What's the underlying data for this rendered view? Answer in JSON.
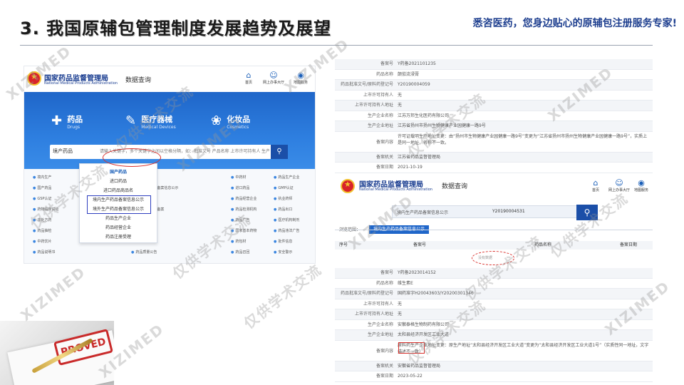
{
  "slide": {
    "title": "3. 我国原辅包管理制度发展趋势及展望",
    "slogan": "悉咨医药，您身边贴心的原辅包注册服务专家!"
  },
  "left_shot": {
    "brand_name": "国家药品监督管理局",
    "brand_en": "National Medical Products Administration",
    "section_label": "数据查询",
    "nav": [
      {
        "label": "首页",
        "icon": "home-icon",
        "glyph": "⌂"
      },
      {
        "label": "网上办事大厅",
        "icon": "user-icon",
        "glyph": "☺"
      },
      {
        "label": "地图服务",
        "icon": "map-pin-icon",
        "glyph": "◉"
      }
    ],
    "categories": [
      {
        "cn": "药品",
        "en": "Drugs",
        "glyph": "✚"
      },
      {
        "cn": "医疗器械",
        "en": "Medical Devices",
        "glyph": "✎"
      },
      {
        "cn": "化妆品",
        "en": "Cosmetics",
        "glyph": "❀"
      }
    ],
    "search": {
      "category": "境产药品",
      "placeholder": "请输入关键字，多个关键字之间以空格分隔，如：批准文号 产品名称 上市许可持有人 生产企业"
    },
    "dropdown": [
      "国产药品",
      "进口药品",
      "进口药品商品名",
      "境内生产药品备案信息公示",
      "境外生产药品备案信息公示",
      "药品生产企业",
      "药品经营企业",
      "药品注册受理"
    ],
    "db_rows": [
      [
        "境内生产",
        "执业药师注册",
        "中药材",
        "药品生产企业"
      ],
      [
        "国产药品",
        "中药配方颗粒备案信息公示",
        "进口药品",
        "GMP认证"
      ],
      [
        "GSP认证",
        "中药保护品种",
        "药品经营企业",
        "执业药师"
      ],
      [
        "药物临床试验",
        "中药配方颗粒备案",
        "药品检测机构",
        "药品出口"
      ],
      [
        "非处方药",
        "药品注册受理",
        "药品广告",
        "医疗机构制剂"
      ],
      [
        "药品抽检",
        "药品注册批件",
        "国家基本药物",
        "药品违法广告"
      ],
      [
        "中药饮片",
        "药用辅料",
        "药包材",
        "批件信息"
      ],
      [
        "药品说明书",
        "药品质量公告",
        "药品召回",
        "安全警示"
      ]
    ]
  },
  "record1": {
    "rows": [
      {
        "label": "备案号",
        "value": "Y药备2021101235"
      },
      {
        "label": "药品名称",
        "value": "颠茄流浸膏"
      },
      {
        "label": "药品批准文号/原料药登记号",
        "value": "Y20190004059"
      },
      {
        "label": "上市许可持有人",
        "value": "无"
      },
      {
        "label": "上市许可持有人地址",
        "value": "无"
      },
      {
        "label": "生产企业名称",
        "value": "江苏万邦生化医药有限公司"
      },
      {
        "label": "生产企业地址",
        "value": "江苏省扬州市扬州生物健康产业园健康一路9号"
      },
      {
        "label": "备案内容",
        "value": "许可证载明生产地址变更：由“扬州市生物健康产业园健康一路9号”变更为“江苏省扬州市扬州生物健康产业园健康一路9号”，实质上是同一地址，名称不一致。"
      },
      {
        "label": "备案机关",
        "value": "江苏省药品监督管理局"
      },
      {
        "label": "备案日期",
        "value": "2021-10-19"
      }
    ]
  },
  "record2": {
    "brand_name": "国家药品监督管理局",
    "brand_en": "National Medical Products Administration",
    "section_label": "数据查询",
    "nav": [
      {
        "label": "首页",
        "icon": "home-icon",
        "glyph": "⌂"
      },
      {
        "label": "网上办事大厅",
        "icon": "user-icon",
        "glyph": "☺"
      },
      {
        "label": "地图服务",
        "icon": "map-pin-icon",
        "glyph": "◉"
      }
    ],
    "search_category": "境内生产药品备案信息公示",
    "search_value": "Y20190004531",
    "tab_label": "浏览范围：",
    "tab": "境内生产药品备案信息公示",
    "headers": [
      "序号",
      "备案号",
      "药品名称",
      "备案日期"
    ],
    "no_data": "没有数据",
    "rows": [
      {
        "label": "备案号",
        "value": "Y药备2023014152"
      },
      {
        "label": "药品名称",
        "value": "维生素E"
      },
      {
        "label": "药品批准文号/原料药登记号",
        "value": "国药准字H20043603/Y20200301346"
      },
      {
        "label": "上市许可持有人",
        "value": "无"
      },
      {
        "label": "上市许可持有人地址",
        "value": "无"
      },
      {
        "label": "生产企业名称",
        "value": "安徽泰格生物制药有限公司"
      },
      {
        "label": "生产企业地址",
        "value": "太和县经济开发区工业大道"
      },
      {
        "label": "备案内容",
        "value": "原料药生产企业地址变更：原生产地址“太和县经济开发区工业大道”变更为“太和县经济开发区工业大道1号”（实质性同一地址，文字描述不一致）"
      },
      {
        "label": "备案机关",
        "value": "安徽省药品监督管理局"
      },
      {
        "label": "备案日期",
        "value": "2023-05-22"
      }
    ]
  },
  "photo": {
    "stamp_text": "PROVED"
  },
  "watermarks": [
    "XIZIMED",
    "仅供学术交流"
  ]
}
